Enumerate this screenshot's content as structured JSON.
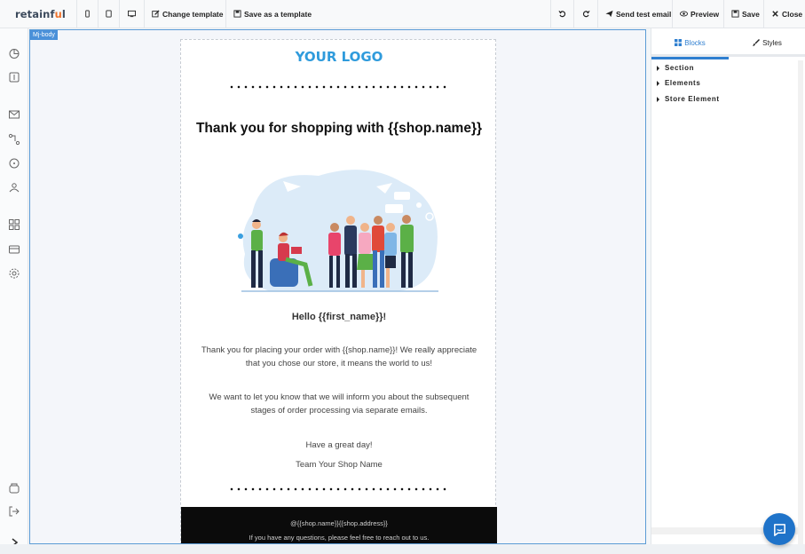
{
  "app": {
    "brand_prefix": "retainf",
    "brand_accent": "u",
    "brand_suffix": "l"
  },
  "toolbar": {
    "device_mobile_icon": "mobile-icon",
    "device_tablet_icon": "tablet-icon",
    "device_desktop_icon": "desktop-icon",
    "change_template": "Change template",
    "save_as_template": "Save as a template",
    "send_test_email": "Send test email",
    "preview": "Preview",
    "save": "Save",
    "close": "Close"
  },
  "canvas": {
    "badge": "Mj-body"
  },
  "email": {
    "logo": "YOUR LOGO",
    "headline": "Thank you for shopping with {{shop.name}}",
    "greeting": "Hello {{first_name}}!",
    "paragraph1": "Thank you for placing your order with {{shop.name}}! We really appreciate that you chose our store, it means the world to us!",
    "paragraph2": "We want to let you know that we will inform you about the subsequent stages of order processing via separate emails.",
    "closing": "Have a great day!",
    "signature": "Team Your Shop Name",
    "footer_address": "@{{shop.name}}{{shop.address}}",
    "footer_help": "If you have any questions, please feel free to reach out to us."
  },
  "right_panel": {
    "tabs": [
      {
        "label": "Blocks",
        "active": true
      },
      {
        "label": "Styles",
        "active": false
      }
    ],
    "tree": [
      {
        "label": "Section"
      },
      {
        "label": "Elements"
      },
      {
        "label": "Store Element"
      }
    ]
  },
  "colors": {
    "accent": "#2f7fd0",
    "logo": "#2f9bdc",
    "brand_accent": "#f0732b",
    "chat": "#1f73c9"
  }
}
